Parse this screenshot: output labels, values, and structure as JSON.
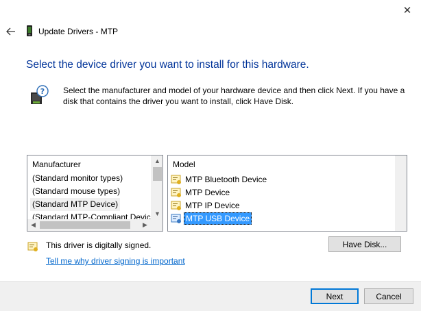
{
  "window": {
    "close_glyph": "✕",
    "title": "Update Drivers - MTP"
  },
  "page": {
    "heading": "Select the device driver you want to install for this hardware.",
    "description": "Select the manufacturer and model of your hardware device and then click Next. If you have a disk that contains the driver you want to install, click Have Disk."
  },
  "manufacturer_list": {
    "header": "Manufacturer",
    "items": [
      {
        "label": "(Standard monitor types)"
      },
      {
        "label": "(Standard mouse types)"
      },
      {
        "label": "(Standard MTP Device)",
        "selected": true
      },
      {
        "label": "(Standard MTP-Compliant Device"
      }
    ]
  },
  "model_list": {
    "header": "Model",
    "items": [
      {
        "label": "MTP Bluetooth Device"
      },
      {
        "label": "MTP Device"
      },
      {
        "label": "MTP IP Device"
      },
      {
        "label": "MTP USB Device",
        "selected": true
      }
    ]
  },
  "signature": {
    "status_text": "This driver is digitally signed.",
    "link_text": "Tell me why driver signing is important"
  },
  "buttons": {
    "have_disk": "Have Disk...",
    "next": "Next",
    "cancel": "Cancel"
  },
  "colors": {
    "heading": "#003399",
    "link": "#0066cc",
    "selection": "#3399ff"
  },
  "icons": {
    "back": "back-arrow-icon",
    "device": "mtp-device-icon",
    "help": "hardware-help-icon",
    "driver": "driver-certificate-icon",
    "signed": "signed-certificate-icon"
  }
}
